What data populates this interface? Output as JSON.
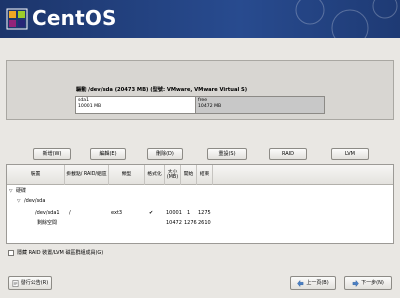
{
  "app": {
    "brand": "CentOS"
  },
  "disk": {
    "title": "驅動 /dev/sda (20473 MB) (型號: VMware, VMware Virtual S)",
    "partitions": [
      {
        "name": "sda1",
        "size": "10001 MB"
      },
      {
        "name": "free",
        "size": "10472 MB"
      }
    ]
  },
  "actions": {
    "new": "新增(W)",
    "edit": "編輯(E)",
    "delete": "刪除(D)",
    "reset": "重設(S)",
    "raid": "RAID",
    "lvm": "LVM"
  },
  "table": {
    "headers": {
      "device": "裝置",
      "mount": "掛載點/ RAID/組區",
      "type": "類型",
      "format": "格式化",
      "size": "大小 (MB)",
      "start": "開始",
      "end": "結束"
    },
    "rows": [
      {
        "device": "硬碟",
        "expander": "▽"
      },
      {
        "device": "/dev/sda",
        "expander": "▽"
      },
      {
        "device": "/dev/sda1",
        "mount": "/",
        "type": "ext3",
        "format": "✔",
        "size": "10001",
        "start": "1",
        "end": "1275"
      },
      {
        "device": "剩餘空間",
        "mount": "",
        "type": "",
        "format": "",
        "size": "10472",
        "start": "1276",
        "end": "2610"
      }
    ]
  },
  "options": {
    "hide_raid_label": "隱藏 RAID 裝置/LVM 磁區群組成員(G)"
  },
  "nav": {
    "release_notes": "發行公告(R)",
    "back": "上一頁(B)",
    "next": "下一步(N)"
  },
  "colors": {
    "banner": "#1d3a73",
    "free_space": "#c8c8c8"
  }
}
